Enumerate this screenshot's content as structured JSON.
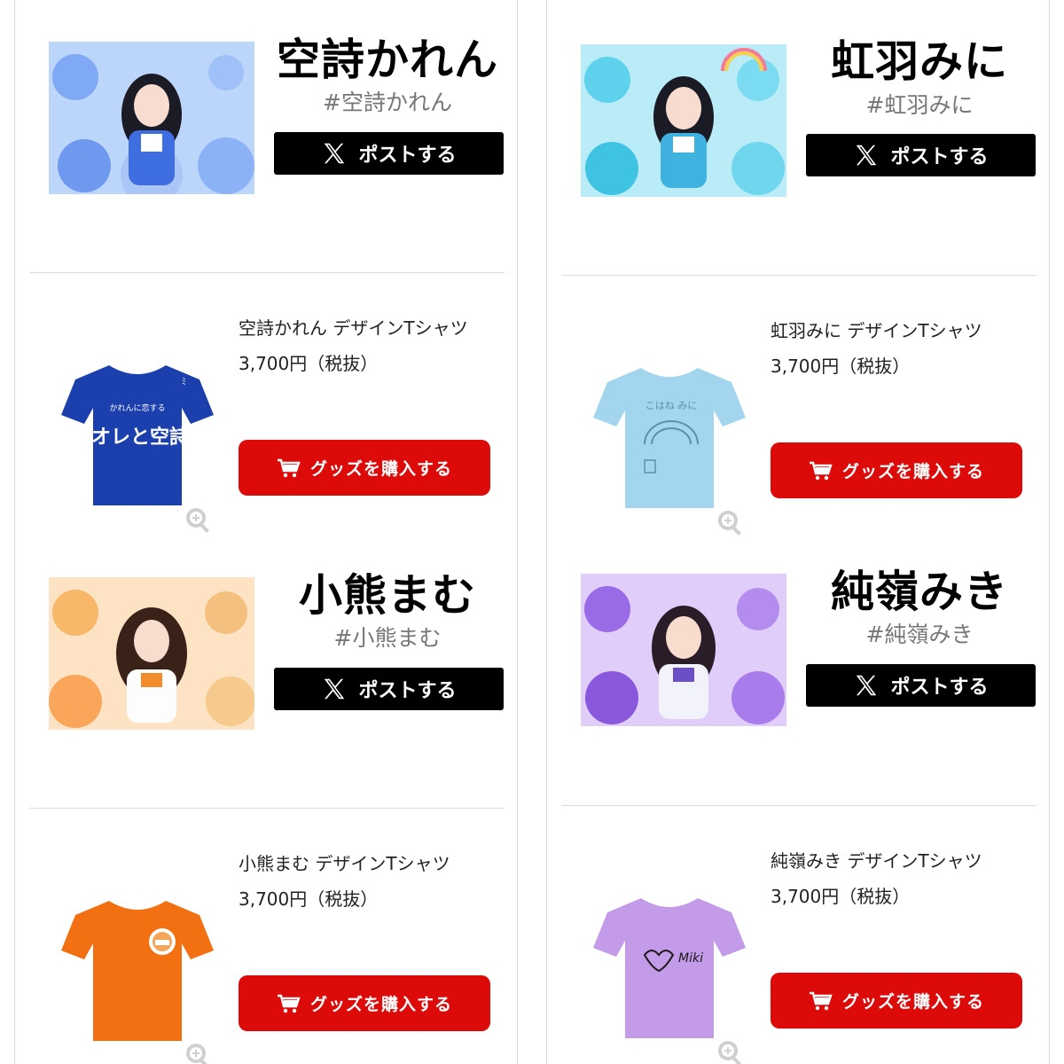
{
  "post_button_label": "ポストする",
  "buy_button_label": "グッズを購入する",
  "members": [
    {
      "name": "空詩かれん",
      "hashtag": "#空詩かれん",
      "product_name": "空詩かれん デザインTシャツ",
      "price": "3,700円（税抜）",
      "theme_color": "#5b8ff0",
      "shirt_color": "#1c3fae",
      "shirt_print": "オレと空詩"
    },
    {
      "name": "虹羽みに",
      "hashtag": "#虹羽みに",
      "product_name": "虹羽みに デザインTシャツ",
      "price": "3,700円（税抜）",
      "theme_color": "#45c9e8",
      "shirt_color": "#a3d6ee",
      "shirt_print": "こはね みに"
    },
    {
      "name": "小熊まむ",
      "hashtag": "#小熊まむ",
      "product_name": "小熊まむ デザインTシャツ",
      "price": "3,700円（税抜）",
      "theme_color": "#f5a54a",
      "shirt_color": "#f26f12",
      "shirt_print": ""
    },
    {
      "name": "純嶺みき",
      "hashtag": "#純嶺みき",
      "product_name": "純嶺みき デザインTシャツ",
      "price": "3,700円（税抜）",
      "theme_color": "#9c6ee6",
      "shirt_color": "#c39be8",
      "shirt_print": "Miki"
    }
  ],
  "icons": {
    "post": "x-logo-icon",
    "buy": "cart-icon",
    "zoom": "zoom-in-icon"
  },
  "colors": {
    "buy_button": "#dd0a0a",
    "post_button": "#000000"
  }
}
